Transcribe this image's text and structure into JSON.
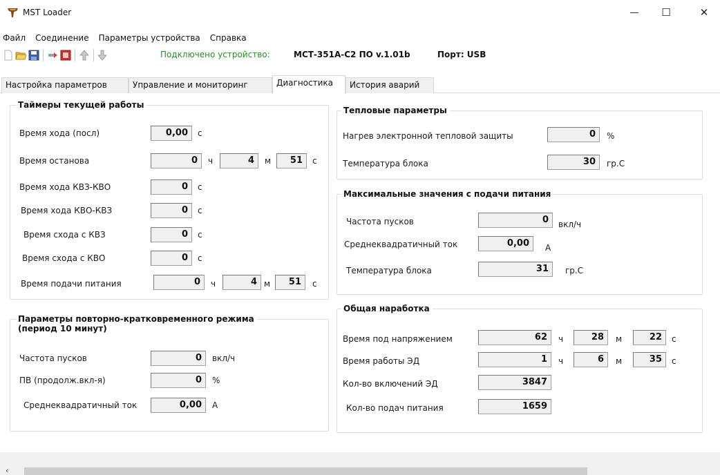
{
  "window": {
    "title": "MST Loader",
    "minimize_glyph": "—",
    "maximize_glyph": "☐",
    "close_glyph": "✕"
  },
  "menu": [
    "Файл",
    "Соединение",
    "Параметры устройства",
    "Справка"
  ],
  "toolbar": {
    "status": "Подключено устройство:",
    "device": "МСТ-351А-С2 ПО v.1.01b",
    "port": "Порт: USB",
    "icons": [
      "new-file-icon",
      "open-folder-icon",
      "save-icon",
      "connect-icon",
      "stop-icon",
      "upload-icon",
      "download-icon"
    ]
  },
  "tabs": [
    {
      "label": "Настройка параметров",
      "active": false
    },
    {
      "label": "Управление и мониторинг",
      "active": false
    },
    {
      "label": "Диагностика",
      "active": true
    },
    {
      "label": "История аварий",
      "active": false
    }
  ],
  "timers": {
    "title": "Таймеры текущей работы",
    "run_time_last": {
      "label": "Время хода (посл)",
      "value": "0,00",
      "unit": "с"
    },
    "stop_time": {
      "label": "Время останова",
      "h": "0",
      "h_unit": "ч",
      "m": "4",
      "m_unit": "м",
      "s": "51",
      "s_unit": "с"
    },
    "run_kvz_kvo": {
      "label": "Время хода КВЗ-КВО",
      "value": "0",
      "unit": "с"
    },
    "run_kvo_kvz": {
      "label": "Время хода КВО-КВЗ",
      "value": "0",
      "unit": "с"
    },
    "leave_kvz": {
      "label": "Время схода с КВЗ",
      "value": "0",
      "unit": "с"
    },
    "leave_kvo": {
      "label": "Время схода с КВО",
      "value": "0",
      "unit": "с"
    },
    "power_time": {
      "label": "Время подачи питания",
      "h": "0",
      "h_unit": "ч",
      "m": "4",
      "m_unit": "м",
      "s": "51",
      "s_unit": "с"
    }
  },
  "intermittent": {
    "title_line1": "Параметры повторно-кратковременного режима",
    "title_line2": "(период 10 минут)",
    "start_freq": {
      "label": "Частота пусков",
      "value": "0",
      "unit": "вкл/ч"
    },
    "duty": {
      "label": "ПВ (продолж.вкл-я)",
      "value": "0",
      "unit": "%"
    },
    "rms_current": {
      "label": "Среднеквадратичный ток",
      "value": "0,00",
      "unit": "А"
    }
  },
  "thermal": {
    "title": "Тепловые параметры",
    "heating": {
      "label": "Нагрев электронной тепловой защиты",
      "value": "0",
      "unit": "%"
    },
    "block_temp": {
      "label": "Температура блока",
      "value": "30",
      "unit": "гр.С"
    }
  },
  "maxvals": {
    "title": "Максимальные значения с подачи питания",
    "start_freq": {
      "label": "Частота пусков",
      "value": "0",
      "unit": "вкл/ч"
    },
    "rms_current": {
      "label": "Среднеквадратичный ток",
      "value": "0,00",
      "unit": "А"
    },
    "block_temp": {
      "label": "Температура блока",
      "value": "31",
      "unit": "гр.С"
    }
  },
  "total": {
    "title": "Общая наработка",
    "under_voltage": {
      "label": "Время под напряжением",
      "h": "62",
      "h_unit": "ч",
      "m": "28",
      "m_unit": "м",
      "s": "22",
      "s_unit": "с"
    },
    "motor_run": {
      "label": "Время работы ЭД",
      "h": "1",
      "h_unit": "ч",
      "m": "6",
      "m_unit": "м",
      "s": "35",
      "s_unit": "с"
    },
    "motor_on_count": {
      "label": "Кол-во включений ЭД",
      "value": "3847"
    },
    "power_on_count": {
      "label": "Кол-во подач питания",
      "value": "1659"
    }
  },
  "scroll": {
    "left_arrow": "‹"
  },
  "colors": {
    "status_green": "#2d8a2d",
    "field_bg": "#f0f0f0",
    "border": "#dcdcdc"
  }
}
